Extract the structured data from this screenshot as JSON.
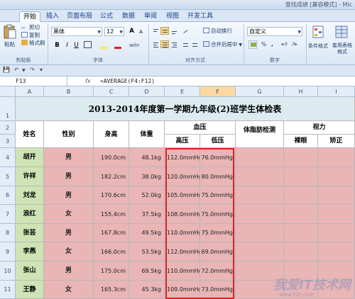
{
  "window": {
    "title": "查找成绩 [兼容模式] - Mic"
  },
  "tabs": [
    {
      "label": "开始",
      "active": true
    },
    {
      "label": "插入"
    },
    {
      "label": "页面布局"
    },
    {
      "label": "公式"
    },
    {
      "label": "数据"
    },
    {
      "label": "审阅"
    },
    {
      "label": "视图"
    },
    {
      "label": "开发工具"
    }
  ],
  "ribbon": {
    "clipboard": {
      "paste": "粘贴",
      "cut": "剪切",
      "copy": "复制",
      "format_painter": "格式刷",
      "group": "剪贴板"
    },
    "font": {
      "name": "黑体",
      "size": "12",
      "grow": "A",
      "shrink": "A",
      "bold": "B",
      "italic": "I",
      "underline": "U",
      "group": "字体",
      "change_case": "wén"
    },
    "alignment": {
      "wrap": "自动换行",
      "merge": "合并后居中",
      "group": "对齐方式"
    },
    "number": {
      "format": "自定义",
      "currency": "%",
      "percent": ",",
      "group": "数字"
    },
    "styles": {
      "conditional": "条件格式",
      "table": "套用表格格式"
    }
  },
  "formula_bar": {
    "name_box": "F13",
    "fx": "fx",
    "formula": "=AVERAGE(F4:F12)"
  },
  "columns": [
    "A",
    "B",
    "C",
    "D",
    "E",
    "F",
    "G",
    "H",
    "I"
  ],
  "rows": [
    "1",
    "2",
    "3",
    "4",
    "5",
    "6",
    "7",
    "8",
    "9",
    "10",
    "11"
  ],
  "sheet": {
    "title": "2013-2014年度第一学期九年级(2)班学生体检表",
    "headers": {
      "name": "姓名",
      "gender": "性别",
      "height": "身高",
      "weight": "体重",
      "blood_pressure": "血压",
      "high": "高压",
      "low": "低压",
      "body_fat": "体脂肪检测",
      "vision": "视力",
      "naked": "裸眼",
      "corrected": "矫正"
    },
    "records": [
      {
        "name": "胡开",
        "gender": "男",
        "height": "190.0cm",
        "weight": "48.1kg",
        "high": "112.0mmHg",
        "low": "76.0mmHg"
      },
      {
        "name": "许祥",
        "gender": "男",
        "height": "182.2cm",
        "weight": "38.0kg",
        "high": "120.0mmHg",
        "low": "80.0mmHg"
      },
      {
        "name": "刘龙",
        "gender": "男",
        "height": "170.6cm",
        "weight": "52.0kg",
        "high": "105.0mmHg",
        "low": "75.0mmHg"
      },
      {
        "name": "浪红",
        "gender": "女",
        "height": "155.4cm",
        "weight": "37.5kg",
        "high": "108.0mmHg",
        "low": "75.0mmHg"
      },
      {
        "name": "张芸",
        "gender": "男",
        "height": "167.8cm",
        "weight": "49.5kg",
        "high": "110.0mmHg",
        "low": "75.0mmHg"
      },
      {
        "name": "李燕",
        "gender": "女",
        "height": "166.0cm",
        "weight": "53.5kg",
        "high": "112.0mmHg",
        "low": "69.0mmHg"
      },
      {
        "name": "张山",
        "gender": "男",
        "height": "175.0cm",
        "weight": "69.5kg",
        "high": "110.0mmHg",
        "low": "72.0mmHg"
      },
      {
        "name": "王静",
        "gender": "女",
        "height": "165.3cm",
        "weight": "45.3kg",
        "high": "109.0mmHg",
        "low": "73.0mmHg"
      }
    ]
  },
  "watermark": {
    "main": "我爱IT技术网",
    "url": "www.52ij.com"
  }
}
